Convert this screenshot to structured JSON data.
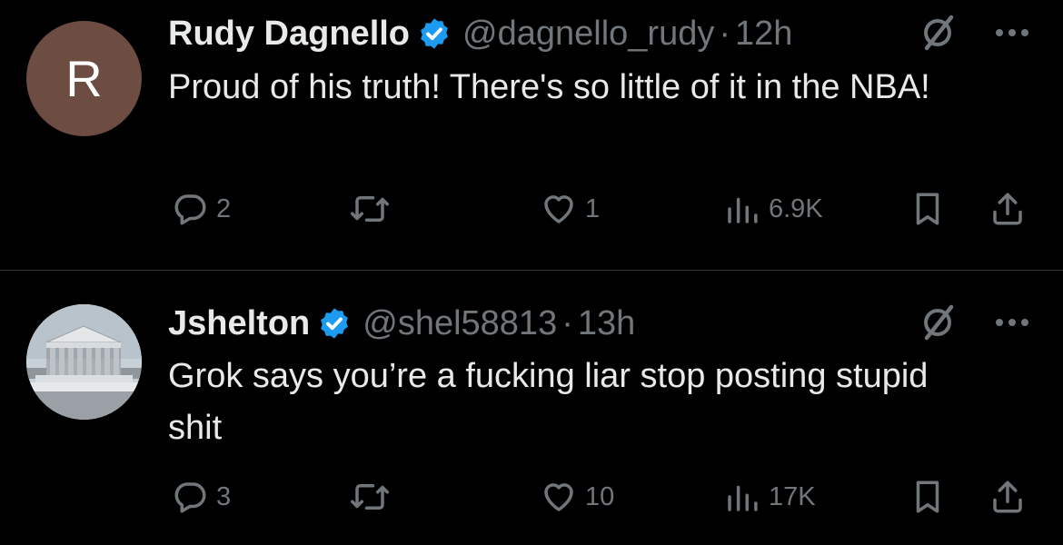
{
  "tweets": [
    {
      "avatar_letter": "R",
      "avatar_color": "#6d4c41",
      "name": "Rudy Dagnello",
      "handle": "@dagnello_rudy",
      "separator": "·",
      "time": "12h",
      "text": "Proud of his truth! There's so little of it in the NBA!",
      "replies": "2",
      "retweets": "",
      "likes": "1",
      "views": "6.9K"
    },
    {
      "avatar_letter": "",
      "avatar_color": "#cfd6dc",
      "name": "Jshelton",
      "handle": "@shel58813",
      "separator": "·",
      "time": "13h",
      "text": "Grok says you’re a fucking liar stop posting stupid shit",
      "replies": "3",
      "retweets": "",
      "likes": "10",
      "views": "17K"
    }
  ],
  "icons": {
    "verified": "verified-badge-icon",
    "grok": "grok-icon",
    "more": "more-icon",
    "reply": "reply-icon",
    "retweet": "retweet-icon",
    "like": "like-icon",
    "views": "views-icon",
    "bookmark": "bookmark-icon",
    "share": "share-icon"
  },
  "colors": {
    "background": "#000000",
    "text": "#e7e9ea",
    "secondary": "#71767b",
    "verified": "#1d9bf0",
    "separator": "#2f3336"
  }
}
